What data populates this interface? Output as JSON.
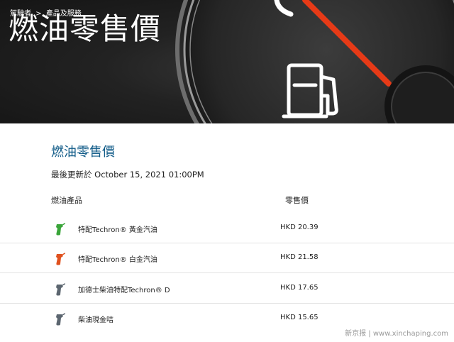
{
  "hero": {
    "breadcrumb": [
      "駕駛者",
      ">",
      "產品及服務"
    ],
    "title": "燃油零售價"
  },
  "main": {
    "section_title": "燃油零售價",
    "last_updated": "最後更新於 October 15, 2021 01:00PM",
    "columns": {
      "product": "燃油產品",
      "price": "零售價"
    },
    "rows": [
      {
        "name": "特配Techron® 黃金汽油",
        "price": "HKD 20.39",
        "icon": "green-fuel-nozzle-icon",
        "color": "#3aa53a"
      },
      {
        "name": "特配Techron® 白金汽油",
        "price": "HKD 21.58",
        "icon": "orange-fuel-nozzle-icon",
        "color": "#e0521f"
      },
      {
        "name": "加德士柴油特配Techron® D",
        "price": "HKD 17.65",
        "icon": "gray-fuel-nozzle-icon",
        "color": "#5c6670"
      },
      {
        "name": "柴油現金咭",
        "price": "HKD 15.65",
        "icon": "gray-fuel-nozzle-icon",
        "color": "#5c6670"
      }
    ]
  },
  "watermark": "新京报 | www.xinchaping.com"
}
